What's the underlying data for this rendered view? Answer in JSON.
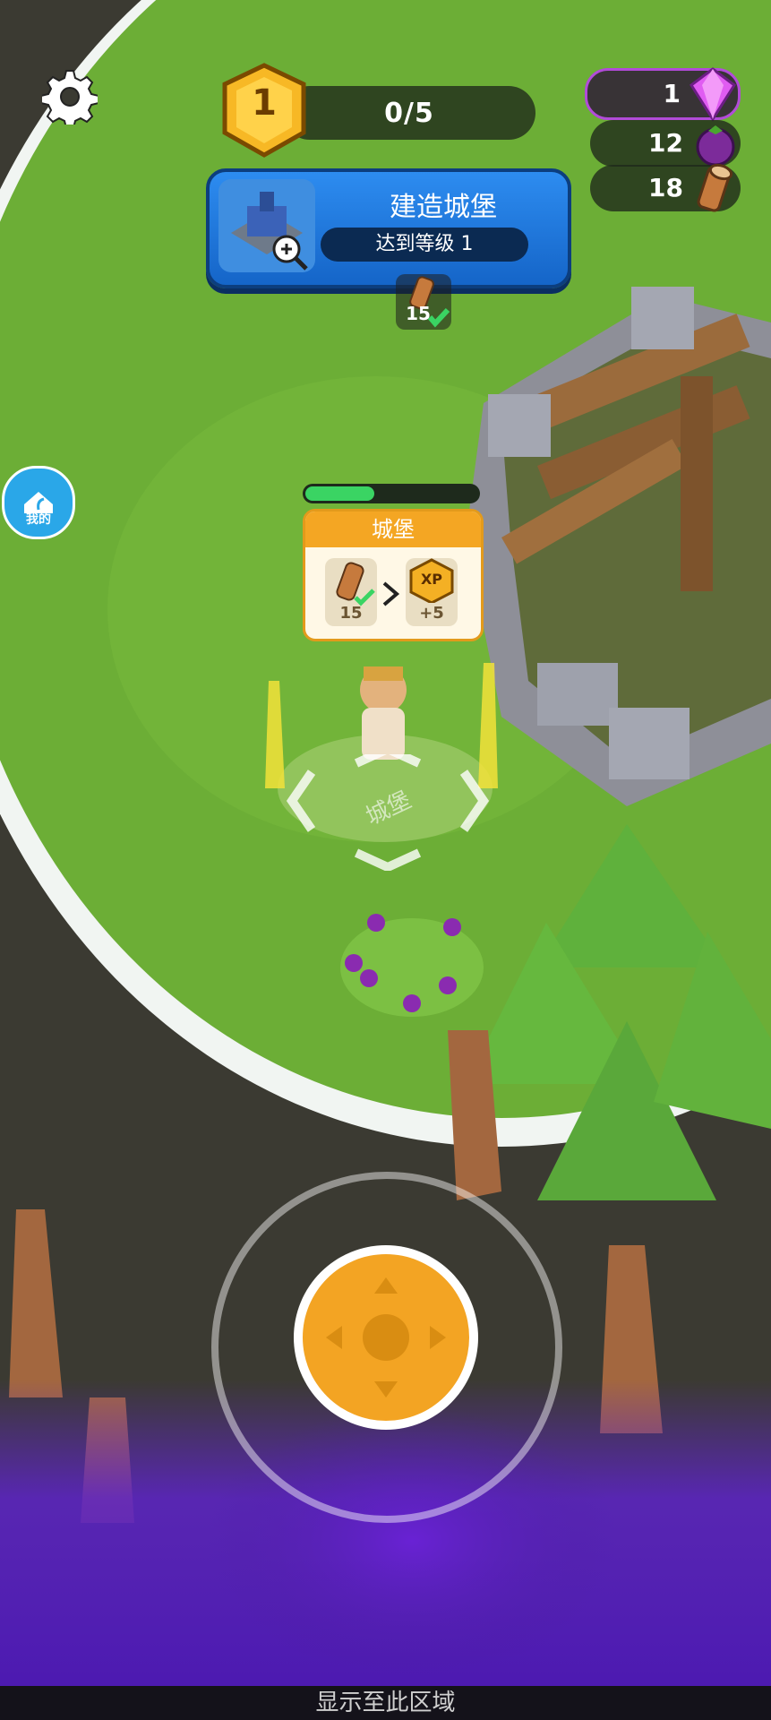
{
  "hud": {
    "level": "1",
    "level_progress": "0/5",
    "gems": "1",
    "fruit": "12",
    "wood": "18"
  },
  "quest": {
    "title": "建造城堡",
    "requirement": "达到等级 1",
    "cost": "15"
  },
  "side": {
    "home_label": "我的"
  },
  "build": {
    "title": "城堡",
    "cost": "15",
    "reward_label": "XP",
    "reward": "+5",
    "progress": 0.4,
    "ground_label": "城堡"
  },
  "footer": {
    "text": "显示至此区域"
  },
  "colors": {
    "grass": "#6cae36",
    "fog": "#5b2fb8",
    "quest_blue": "#2d8cf0",
    "gold": "#f4a623"
  }
}
